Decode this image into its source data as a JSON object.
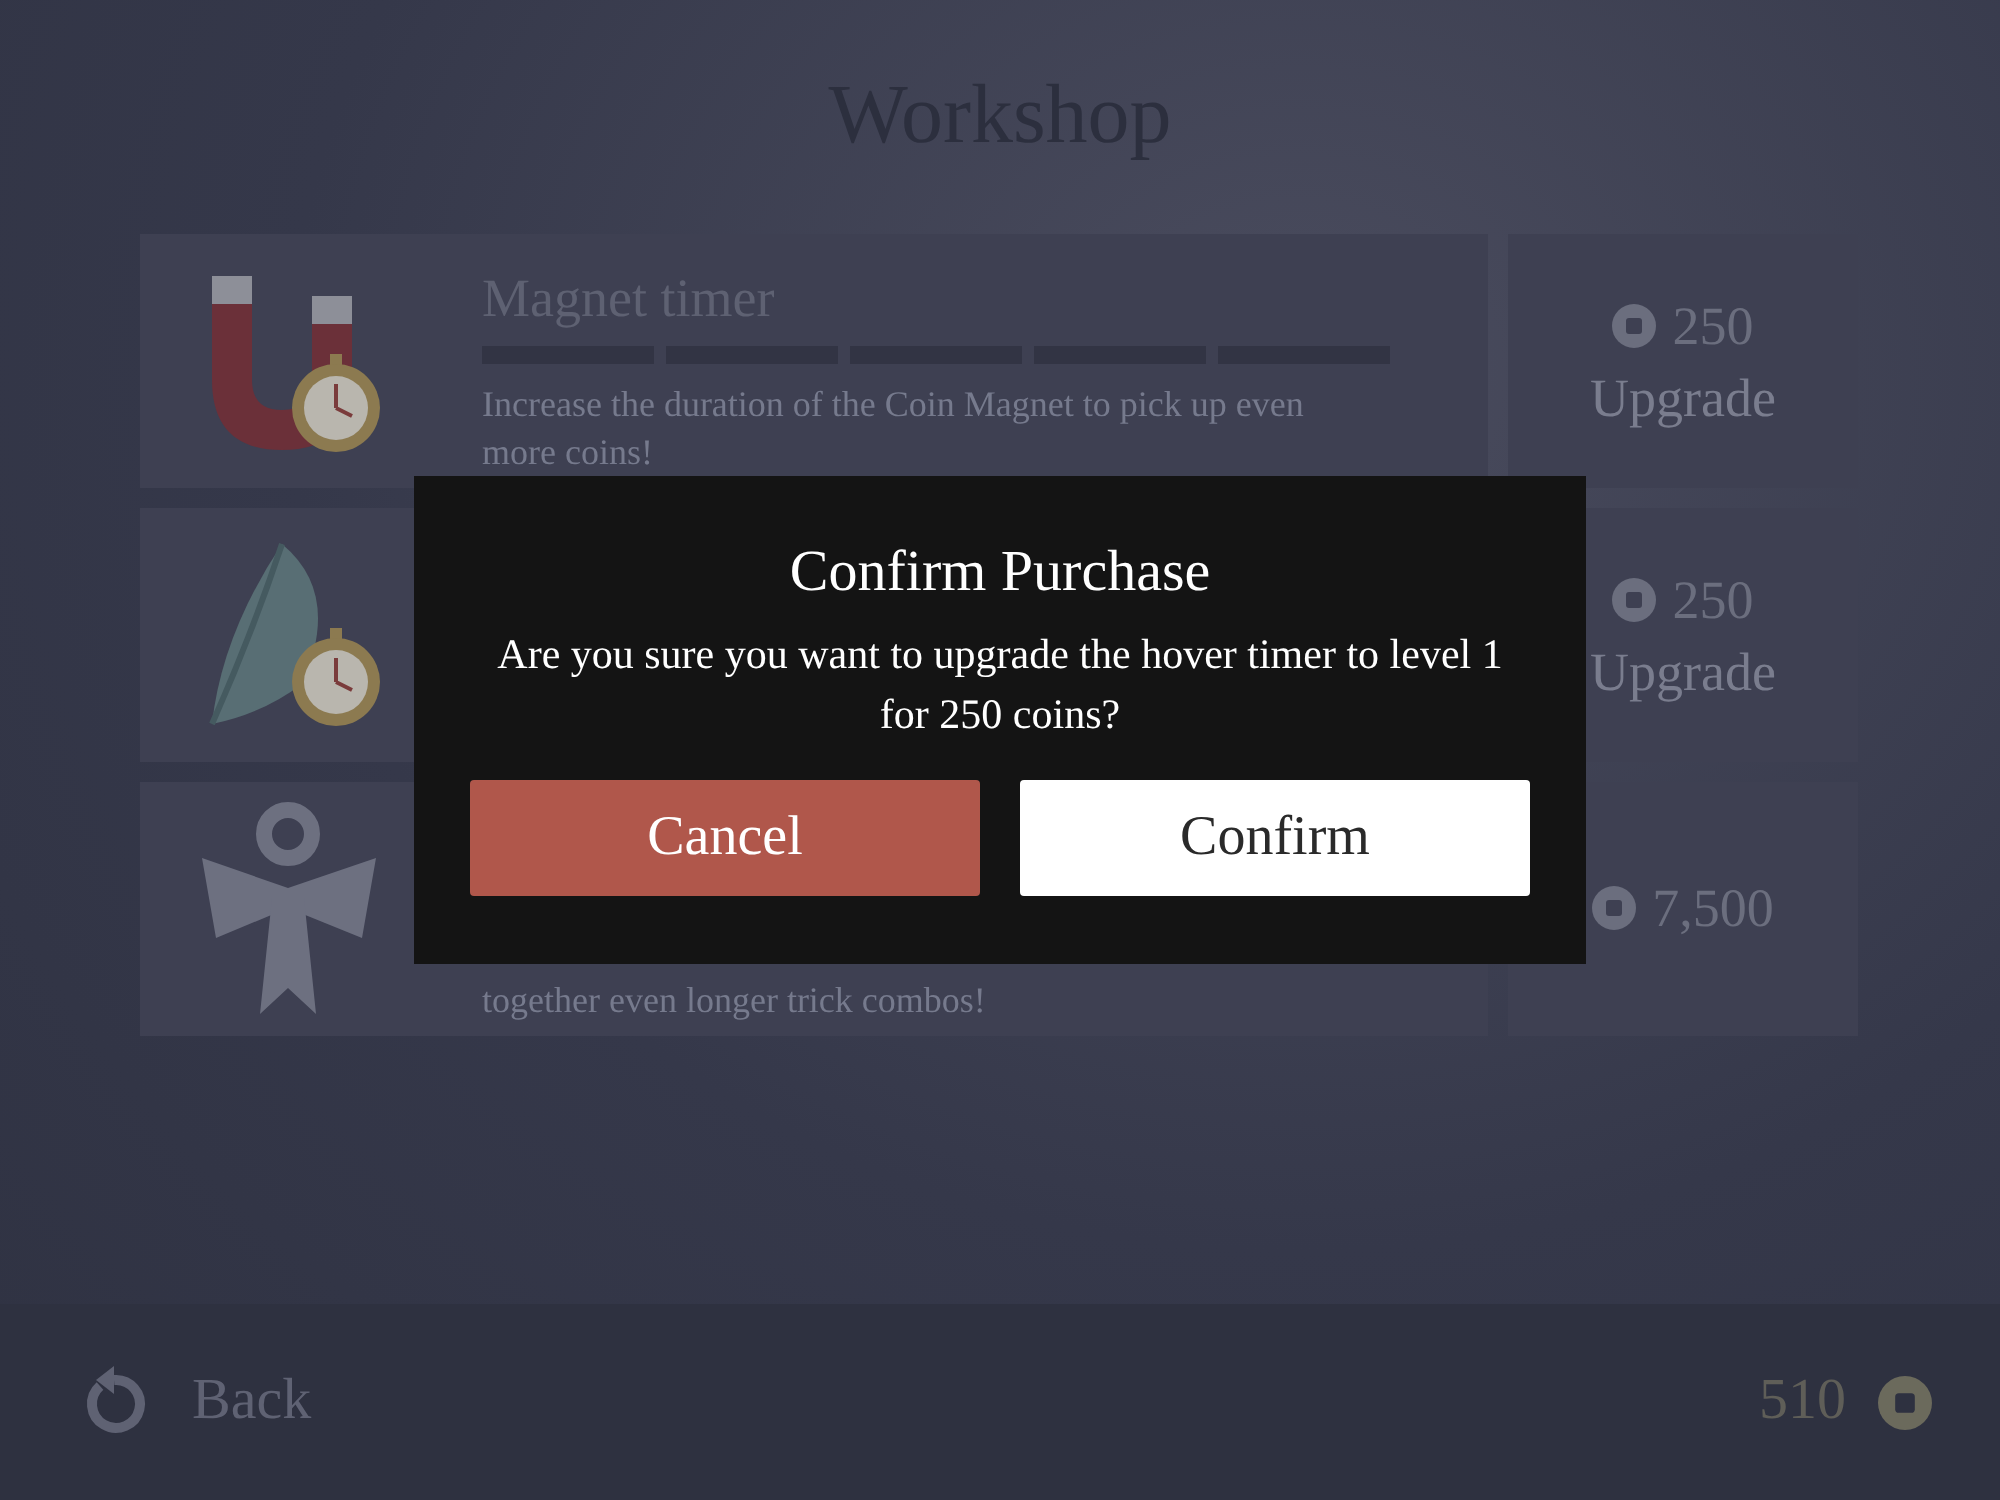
{
  "title": "Workshop",
  "upgrades": [
    {
      "kind": "magnet",
      "name": "Magnet timer",
      "description": "Increase the duration of the Coin Magnet to pick up even more coins!",
      "price": "250",
      "action": "Upgrade"
    },
    {
      "kind": "hover",
      "price": "250",
      "action": "Upgrade"
    },
    {
      "kind": "ribbon",
      "description": "together even longer trick combos!",
      "price": "7,500"
    }
  ],
  "dialog": {
    "title": "Confirm Purchase",
    "message": "Are you sure you want to upgrade the hover timer to level 1 for 250 coins?",
    "buttons": [
      {
        "label": "Cancel",
        "kind": "cancel"
      },
      {
        "label": "Confirm",
        "kind": "confirm"
      }
    ]
  },
  "footer": {
    "back": "Back",
    "coins": "510"
  }
}
